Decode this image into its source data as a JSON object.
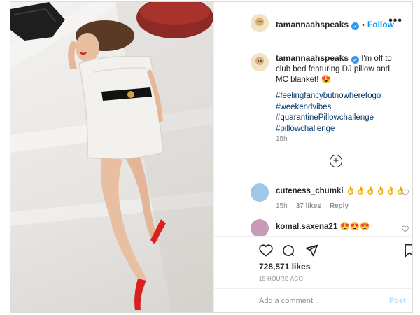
{
  "post": {
    "username": "tamannaahspeaks",
    "verified_mark": "✓",
    "separator": "•",
    "follow_label": "Follow",
    "more_icon": "•••",
    "caption": "I'm off to club bed featuring DJ pillow and MC blanket! 😍",
    "hashtags": [
      "#feelingfancybutnowheretogo",
      "#weekendvibes",
      "#quarantinePillowchallenge",
      "#pillowchallenge"
    ],
    "caption_time": "15h",
    "load_more_icon": "+"
  },
  "comments": [
    {
      "username": "cuteness_chumki",
      "text": "👌👌👌👌👌👌",
      "time": "15h",
      "likes": "37 likes",
      "reply": "Reply"
    },
    {
      "username": "komal.saxena21",
      "text": "😍😍😍"
    }
  ],
  "actions": {
    "likes": "728,571 likes",
    "posted": "15 HOURS AGO",
    "comment_placeholder": "Add a comment...",
    "post_label": "Post"
  },
  "icons": [
    "heart-icon",
    "comment-icon",
    "share-icon",
    "bookmark-icon",
    "more-icon",
    "plus-circle-icon"
  ],
  "colors": {
    "link": "#00376b",
    "follow": "#0095f6",
    "verified": "#3897f0",
    "muted": "#8e8e8e"
  }
}
